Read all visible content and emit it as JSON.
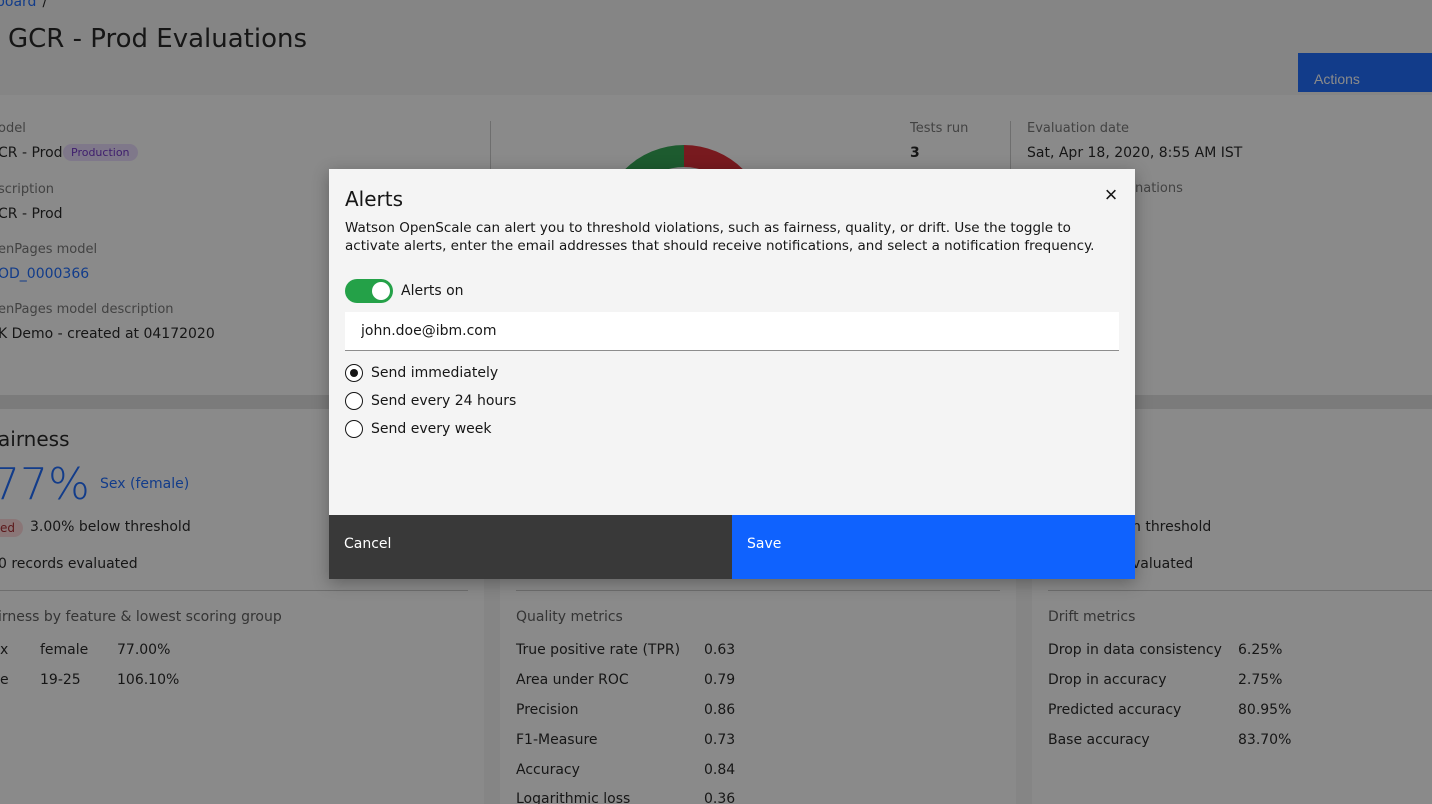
{
  "header": {
    "breadcrumb": "board",
    "breadcrumb_sep": "/",
    "title": "GCR - Prod Evaluations",
    "actions_label": "Actions"
  },
  "info": {
    "model_label": "odel",
    "model_value": "CR - Prod",
    "model_tag": "Production",
    "description_label": "scription",
    "description_value": "CR - Prod",
    "openpages_label": "enPages model",
    "openpages_value": "OD_0000366",
    "openpages_desc_label": "enPages model description",
    "openpages_desc_value": "K Demo - created at 04172020",
    "tests_run_label": "Tests run",
    "tests_run_value": "3",
    "eval_date_label": "Evaluation date",
    "eval_date_value": "Sat, Apr 18, 2020, 8:55 AM IST",
    "explanations_label": "nations"
  },
  "fairness": {
    "title": "airness",
    "score": "77%",
    "group_link": "Sex (female)",
    "status_pill": "ed",
    "threshold_text": "3.00% below threshold",
    "records_text": "0 records evaluated",
    "section_label": "irness by feature & lowest scoring group",
    "rows": [
      {
        "feature": "x",
        "group": "female",
        "value": "77.00%"
      },
      {
        "feature": "e",
        "group": "19-25",
        "value": "106.10%"
      }
    ]
  },
  "quality": {
    "section_label": "Quality metrics",
    "rows": [
      {
        "name": "True positive rate (TPR)",
        "value": "0.63"
      },
      {
        "name": "Area under ROC",
        "value": "0.79"
      },
      {
        "name": "Precision",
        "value": "0.86"
      },
      {
        "name": "F1-Measure",
        "value": "0.73"
      },
      {
        "name": "Accuracy",
        "value": "0.84"
      },
      {
        "name": "Logarithmic loss",
        "value": "0.36"
      }
    ]
  },
  "drift": {
    "threshold_text": "n threshold",
    "records_text": "valuated",
    "section_label": "Drift metrics",
    "rows": [
      {
        "name": "Drop in data consistency",
        "value": "6.25%"
      },
      {
        "name": "Drop in accuracy",
        "value": "2.75%"
      },
      {
        "name": "Predicted accuracy",
        "value": "80.95%"
      },
      {
        "name": "Base accuracy",
        "value": "83.70%"
      }
    ]
  },
  "modal": {
    "title": "Alerts",
    "close_glyph": "×",
    "description": "Watson OpenScale can alert you to threshold violations, such as fairness, quality, or drift. Use the toggle to activate alerts, enter the email addresses that should receive notifications, and select a notification frequency.",
    "toggle_label": "Alerts on",
    "email_value": "john.doe@ibm.com",
    "frequency_options": [
      "Send immediately",
      "Send every 24 hours",
      "Send every week"
    ],
    "selected_frequency": "Send immediately",
    "cancel_label": "Cancel",
    "save_label": "Save"
  },
  "colors": {
    "primary": "#0f62fe",
    "success": "#24a148",
    "danger": "#da1e28",
    "tag_bg": "#e8daff"
  },
  "icons": {
    "close": "close-icon"
  }
}
